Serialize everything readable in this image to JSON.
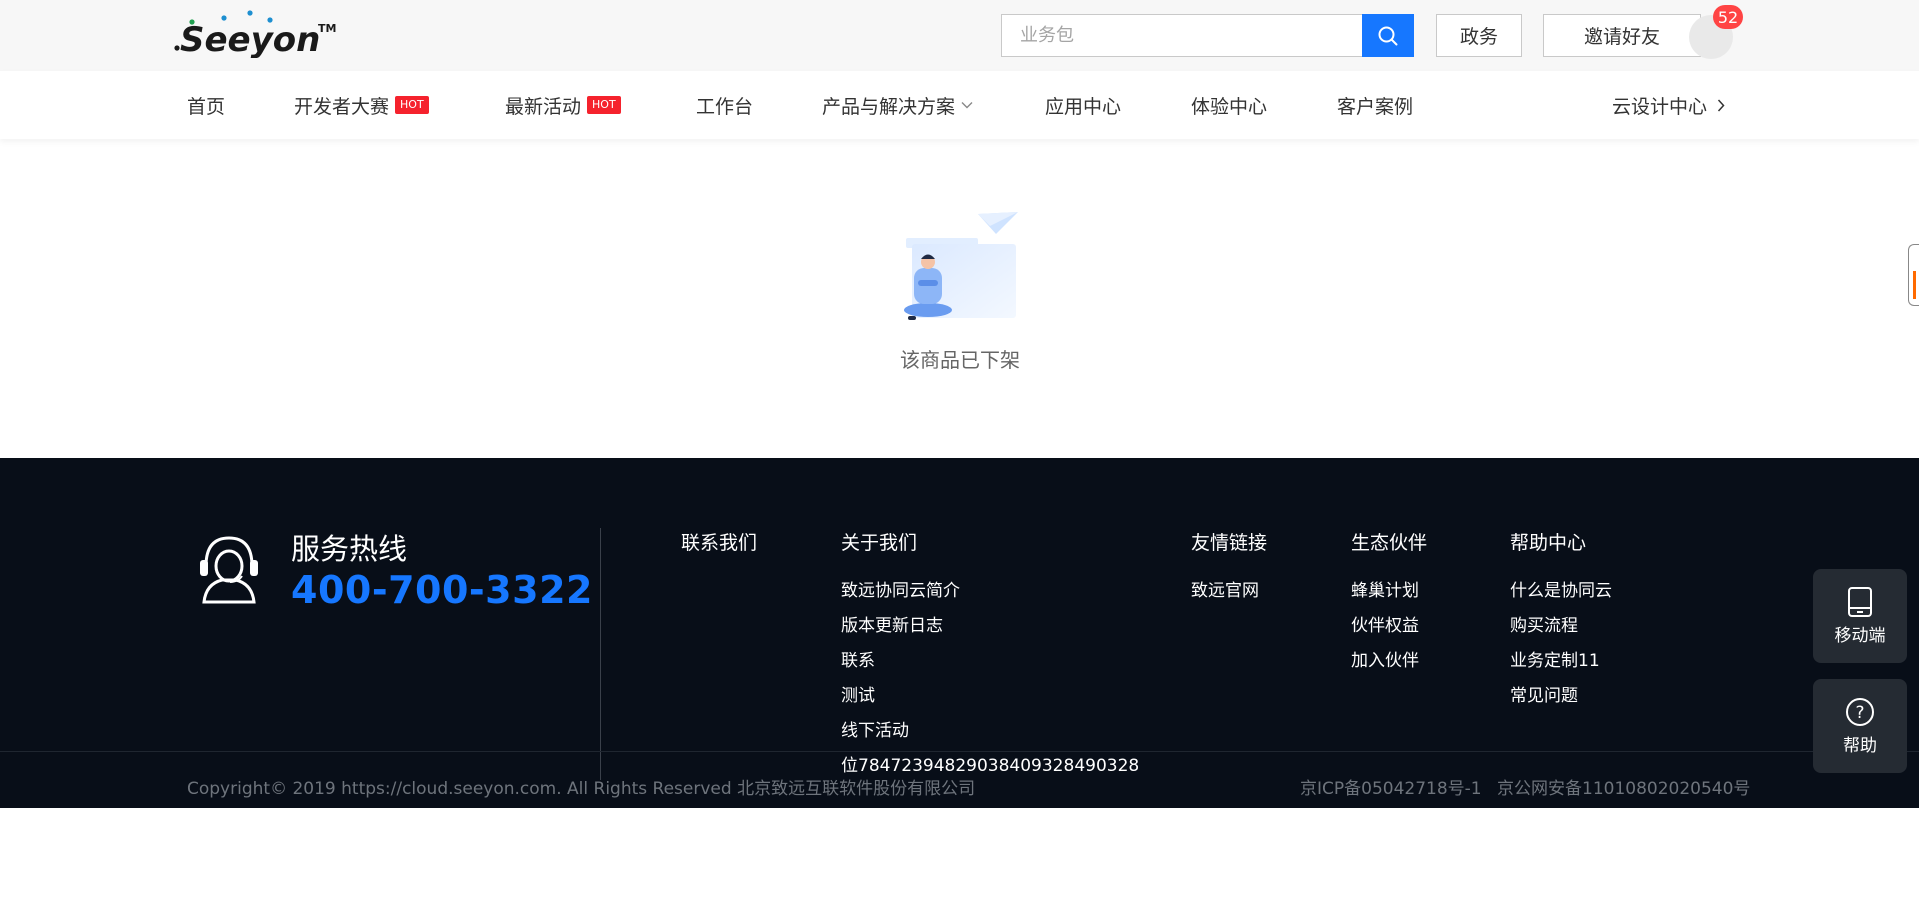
{
  "header": {
    "search_placeholder": "业务包",
    "btn_gov": "政务",
    "btn_invite": "邀请好友",
    "badge_count": "52"
  },
  "nav": {
    "items": [
      {
        "label": "首页"
      },
      {
        "label": "开发者大赛",
        "tag": "HOT"
      },
      {
        "label": "最新活动",
        "tag": "HOT"
      },
      {
        "label": "工作台"
      },
      {
        "label": "产品与解决方案"
      },
      {
        "label": "应用中心"
      },
      {
        "label": "体验中心"
      },
      {
        "label": "客户案例"
      },
      {
        "label": "云设计中心"
      }
    ]
  },
  "main": {
    "empty_text": "该商品已下架"
  },
  "footer": {
    "hotline_title": "服务热线",
    "hotline_phone": "400-700-3322",
    "columns": [
      {
        "title": "联系我们",
        "items": []
      },
      {
        "title": "关于我们",
        "items": [
          "致远协同云简介",
          "版本更新日志",
          "联系",
          "测试",
          "线下活动",
          "位7847239482903840932849032​8"
        ]
      },
      {
        "title": "友情链接",
        "items": [
          "致远官网"
        ]
      },
      {
        "title": "生态伙伴",
        "items": [
          "蜂巢计划",
          "伙伴权益",
          "加入伙伴"
        ]
      },
      {
        "title": "帮助中心",
        "items": [
          "什么是协同云",
          "购买流程",
          "业务定制11",
          "常见问题"
        ]
      }
    ],
    "copyright": "Copyright© 2019 https://cloud.seeyon.com. All Rights Reserved 北京致远互联软件股份有限公司",
    "icp": "京ICP备05042718号-1",
    "police": "京公网安备11010802020540号"
  },
  "float": {
    "mobile_label": "移动端",
    "help_label": "帮助"
  },
  "colors": {
    "accent": "#1677ff",
    "hot": "#f5222d",
    "footer_bg": "#080e18"
  }
}
